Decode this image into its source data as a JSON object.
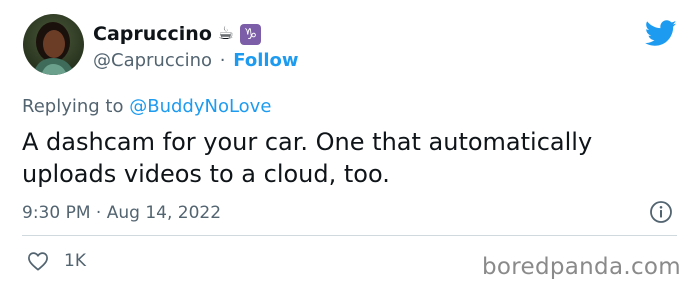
{
  "author": {
    "display_name": "Capruccino",
    "name_emoji": "☕",
    "zodiac_badge": "♑",
    "handle": "@Capruccino",
    "separator": "·",
    "follow_label": "Follow"
  },
  "reply": {
    "prefix": "Replying to",
    "mention": "@BuddyNoLove"
  },
  "tweet": {
    "text": "A dashcam for your car. One that automatically uploads videos to a cloud, too."
  },
  "meta": {
    "time": "9:30 PM",
    "separator": "·",
    "date": "Aug 14, 2022"
  },
  "actions": {
    "like_count": "1K"
  },
  "watermark": "boredpanda.com",
  "colors": {
    "accent": "#1d9bf0",
    "muted": "#536471",
    "text": "#0f1419",
    "divider": "#cfd9de"
  },
  "icons": [
    "avatar",
    "coffee-emoji",
    "capricorn-badge",
    "twitter-bird-icon",
    "info-icon",
    "heart-icon"
  ]
}
